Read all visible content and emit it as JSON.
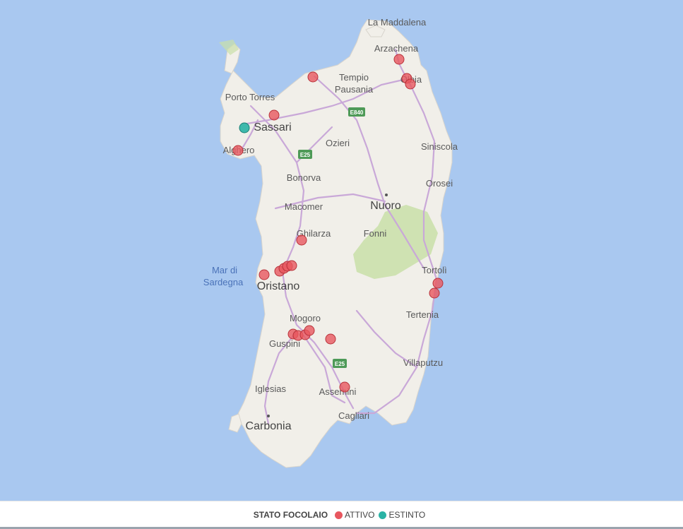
{
  "map": {
    "colors": {
      "sea": "#a9c8f0",
      "land": "#f1efe9",
      "forest": "#c9dfa8",
      "road": "#c9a8d8",
      "motorway_shield": "#4e9a57",
      "attivo": "#e8575f",
      "estinto": "#2ab3a5"
    },
    "places": [
      {
        "name": "La Maddalena",
        "big": false
      },
      {
        "name": "Arzachena",
        "big": false
      },
      {
        "name": "Tempio",
        "big": false
      },
      {
        "name": "Pausania",
        "big": false
      },
      {
        "name": "Olbia",
        "big": false
      },
      {
        "name": "Porto Torres",
        "big": false
      },
      {
        "name": "Sassari",
        "big": true
      },
      {
        "name": "Alghero",
        "big": false
      },
      {
        "name": "Ozieri",
        "big": false
      },
      {
        "name": "Siniscola",
        "big": false
      },
      {
        "name": "Bonorva",
        "big": false
      },
      {
        "name": "Orosei",
        "big": false
      },
      {
        "name": "Macomer",
        "big": false
      },
      {
        "name": "Nuoro",
        "big": true
      },
      {
        "name": "Ghilarza",
        "big": false
      },
      {
        "name": "Fonni",
        "big": false
      },
      {
        "name": "Tortolì",
        "big": false
      },
      {
        "name": "Oristano",
        "big": true
      },
      {
        "name": "Tertenia",
        "big": false
      },
      {
        "name": "Mogoro",
        "big": false
      },
      {
        "name": "Guspini",
        "big": false
      },
      {
        "name": "Villaputzu",
        "big": false
      },
      {
        "name": "Iglesias",
        "big": false
      },
      {
        "name": "Assemini",
        "big": false
      },
      {
        "name": "Cagliari",
        "big": false
      },
      {
        "name": "Carbonia",
        "big": true
      }
    ],
    "sea_labels": [
      "Mar di",
      "Sardegna"
    ],
    "road_shields": [
      "E840",
      "E25",
      "E25"
    ]
  },
  "legend": {
    "title": "STATO FOCOLAIO",
    "items": [
      {
        "label": "ATTIVO",
        "color": "#e8575f"
      },
      {
        "label": "ESTINTO",
        "color": "#2ab3a5"
      }
    ]
  }
}
